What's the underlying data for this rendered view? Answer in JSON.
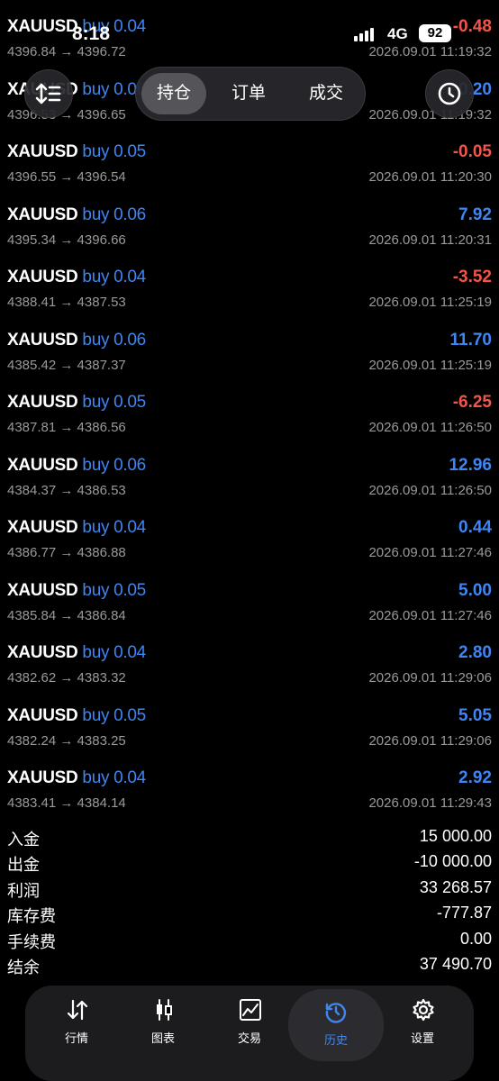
{
  "status_bar": {
    "time": "8:18",
    "network": "4G",
    "battery": "92"
  },
  "tabs": [
    {
      "label": "持仓",
      "active": true
    },
    {
      "label": "订单",
      "active": false
    },
    {
      "label": "成交",
      "active": false
    }
  ],
  "trades": [
    {
      "symbol": "XAUUSD",
      "side": "buy",
      "volume": "0.04",
      "prices": "4396.84 → 4396.72",
      "profit": "-0.48",
      "time": "2026.09.01 11:19:32",
      "sign": "neg"
    },
    {
      "symbol": "XAUUSD",
      "side": "buy",
      "volume": "0.06",
      "prices": "4396.53 → 4396.65",
      "profit": "0.20",
      "time": "2026.09.01 11:19:32",
      "sign": "pos"
    },
    {
      "symbol": "XAUUSD",
      "side": "buy",
      "volume": "0.05",
      "prices": "4396.55 → 4396.54",
      "profit": "-0.05",
      "time": "2026.09.01 11:20:30",
      "sign": "neg"
    },
    {
      "symbol": "XAUUSD",
      "side": "buy",
      "volume": "0.06",
      "prices": "4395.34 → 4396.66",
      "profit": "7.92",
      "time": "2026.09.01 11:20:31",
      "sign": "pos"
    },
    {
      "symbol": "XAUUSD",
      "side": "buy",
      "volume": "0.04",
      "prices": "4388.41 → 4387.53",
      "profit": "-3.52",
      "time": "2026.09.01 11:25:19",
      "sign": "neg"
    },
    {
      "symbol": "XAUUSD",
      "side": "buy",
      "volume": "0.06",
      "prices": "4385.42 → 4387.37",
      "profit": "11.70",
      "time": "2026.09.01 11:25:19",
      "sign": "pos"
    },
    {
      "symbol": "XAUUSD",
      "side": "buy",
      "volume": "0.05",
      "prices": "4387.81 → 4386.56",
      "profit": "-6.25",
      "time": "2026.09.01 11:26:50",
      "sign": "neg"
    },
    {
      "symbol": "XAUUSD",
      "side": "buy",
      "volume": "0.06",
      "prices": "4384.37 → 4386.53",
      "profit": "12.96",
      "time": "2026.09.01 11:26:50",
      "sign": "pos"
    },
    {
      "symbol": "XAUUSD",
      "side": "buy",
      "volume": "0.04",
      "prices": "4386.77 → 4386.88",
      "profit": "0.44",
      "time": "2026.09.01 11:27:46",
      "sign": "pos"
    },
    {
      "symbol": "XAUUSD",
      "side": "buy",
      "volume": "0.05",
      "prices": "4385.84 → 4386.84",
      "profit": "5.00",
      "time": "2026.09.01 11:27:46",
      "sign": "pos"
    },
    {
      "symbol": "XAUUSD",
      "side": "buy",
      "volume": "0.04",
      "prices": "4382.62 → 4383.32",
      "profit": "2.80",
      "time": "2026.09.01 11:29:06",
      "sign": "pos"
    },
    {
      "symbol": "XAUUSD",
      "side": "buy",
      "volume": "0.05",
      "prices": "4382.24 → 4383.25",
      "profit": "5.05",
      "time": "2026.09.01 11:29:06",
      "sign": "pos"
    },
    {
      "symbol": "XAUUSD",
      "side": "buy",
      "volume": "0.04",
      "prices": "4383.41 → 4384.14",
      "profit": "2.92",
      "time": "2026.09.01 11:29:43",
      "sign": "pos"
    }
  ],
  "summary": [
    {
      "label": "入金",
      "value": "15 000.00"
    },
    {
      "label": "出金",
      "value": "-10 000.00"
    },
    {
      "label": "利润",
      "value": "33 268.57"
    },
    {
      "label": "库存费",
      "value": "-777.87"
    },
    {
      "label": "手续费",
      "value": "0.00"
    },
    {
      "label": "结余",
      "value": "37 490.70"
    }
  ],
  "bottom_nav": [
    {
      "label": "行情",
      "icon": "quotes-arrows-icon",
      "active": false
    },
    {
      "label": "图表",
      "icon": "candlestick-chart-icon",
      "active": false
    },
    {
      "label": "交易",
      "icon": "trade-line-chart-icon",
      "active": false
    },
    {
      "label": "历史",
      "icon": "history-clock-icon",
      "active": true
    },
    {
      "label": "设置",
      "icon": "gear-icon",
      "active": false
    }
  ],
  "colors": {
    "profit_positive": "#3f86f2",
    "profit_negative": "#f2554a",
    "volume": "#3f86f2",
    "muted": "#9a9a9a"
  }
}
